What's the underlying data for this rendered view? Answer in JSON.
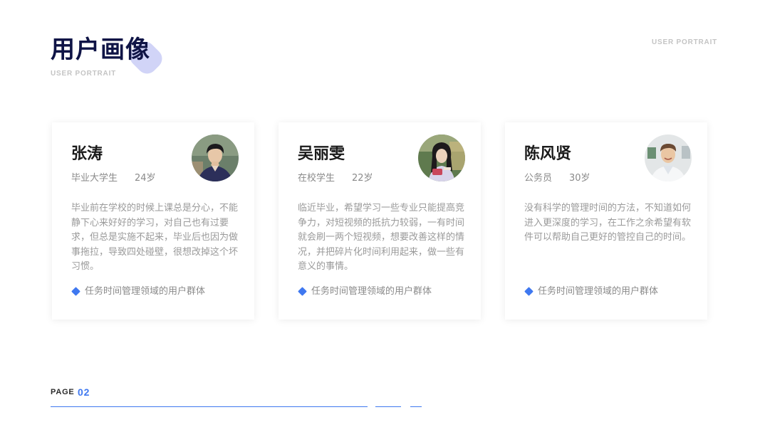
{
  "header": {
    "title": "用户画像",
    "subtitle": "USER PORTRAIT",
    "corner_label": "USER PORTRAIT"
  },
  "colors": {
    "accent": "#3f78f0",
    "title": "#0f1446",
    "title_blob": "#c9cdf6"
  },
  "cards": [
    {
      "name": "张涛",
      "role": "毕业大学生",
      "age": "24岁",
      "description": "毕业前在学校的时候上课总是分心，不能静下心来好好的学习，对自己也有过要求，但总是实施不起来，毕业后也因为做事拖拉，导致四处碰壁，很想改掉这个坏习惯。",
      "tag": "任务时间管理领域的用户群体",
      "avatar_icon": "young-man-photo"
    },
    {
      "name": "吴丽雯",
      "role": "在校学生",
      "age": "22岁",
      "description": "临近毕业，希望学习一些专业只能提高竞争力，对短视频的抵抗力较弱，一有时间就会刷一两个短视频，想要改善这样的情况，并把碎片化时间利用起来，做一些有意义的事情。",
      "tag": "任务时间管理领域的用户群体",
      "avatar_icon": "young-woman-photo"
    },
    {
      "name": "陈风贤",
      "role": "公务员",
      "age": "30岁",
      "description": "没有科学的管理时间的方法，不知道如何进入更深度的学习，在工作之余希望有软件可以帮助自己更好的管控自己的时间。",
      "tag": "任务时间管理领域的用户群体",
      "avatar_icon": "smiling-man-photo"
    }
  ],
  "footer": {
    "page_label": "PAGE",
    "page_number": "02"
  }
}
